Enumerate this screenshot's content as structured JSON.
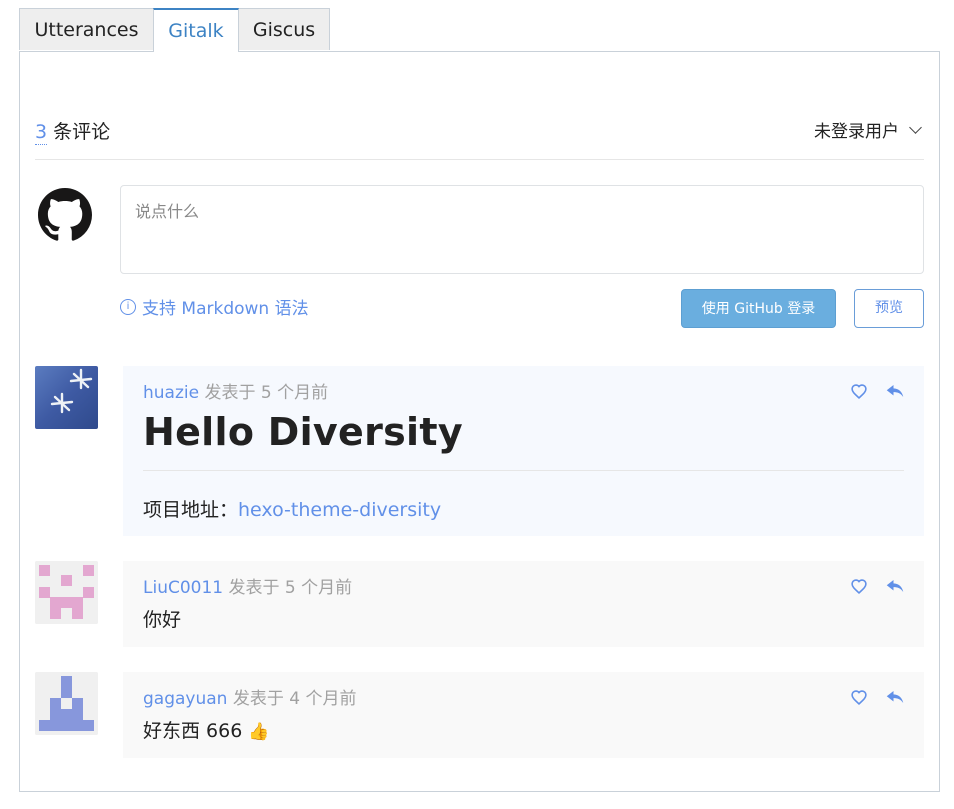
{
  "tabs": [
    {
      "label": "Utterances",
      "active": false
    },
    {
      "label": "Gitalk",
      "active": true
    },
    {
      "label": "Giscus",
      "active": false
    }
  ],
  "header": {
    "count": "3",
    "count_suffix": "条评论",
    "user_menu": "未登录用户"
  },
  "editor": {
    "placeholder": "说点什么",
    "markdown_tip": "支持 Markdown 语法",
    "login_button": "使用 GitHub 登录",
    "preview_button": "预览"
  },
  "comments": [
    {
      "author": "huazie",
      "meta": "发表于 5 个月前",
      "heading": "Hello Diversity",
      "body_label": "项目地址：",
      "body_link": "hexo-theme-diversity"
    },
    {
      "author": "LiuC0011",
      "meta": "发表于 5 个月前",
      "body": "你好"
    },
    {
      "author": "gagayuan",
      "meta": "发表于 4 个月前",
      "body": "好东西 666",
      "emoji": "👍"
    }
  ],
  "colors": {
    "accent": "#6190e8",
    "tab_active": "#3d83c4",
    "login_button": "#6aaedf",
    "identicon_pink": "#e3a7d0",
    "identicon_blue": "#8797dc"
  }
}
